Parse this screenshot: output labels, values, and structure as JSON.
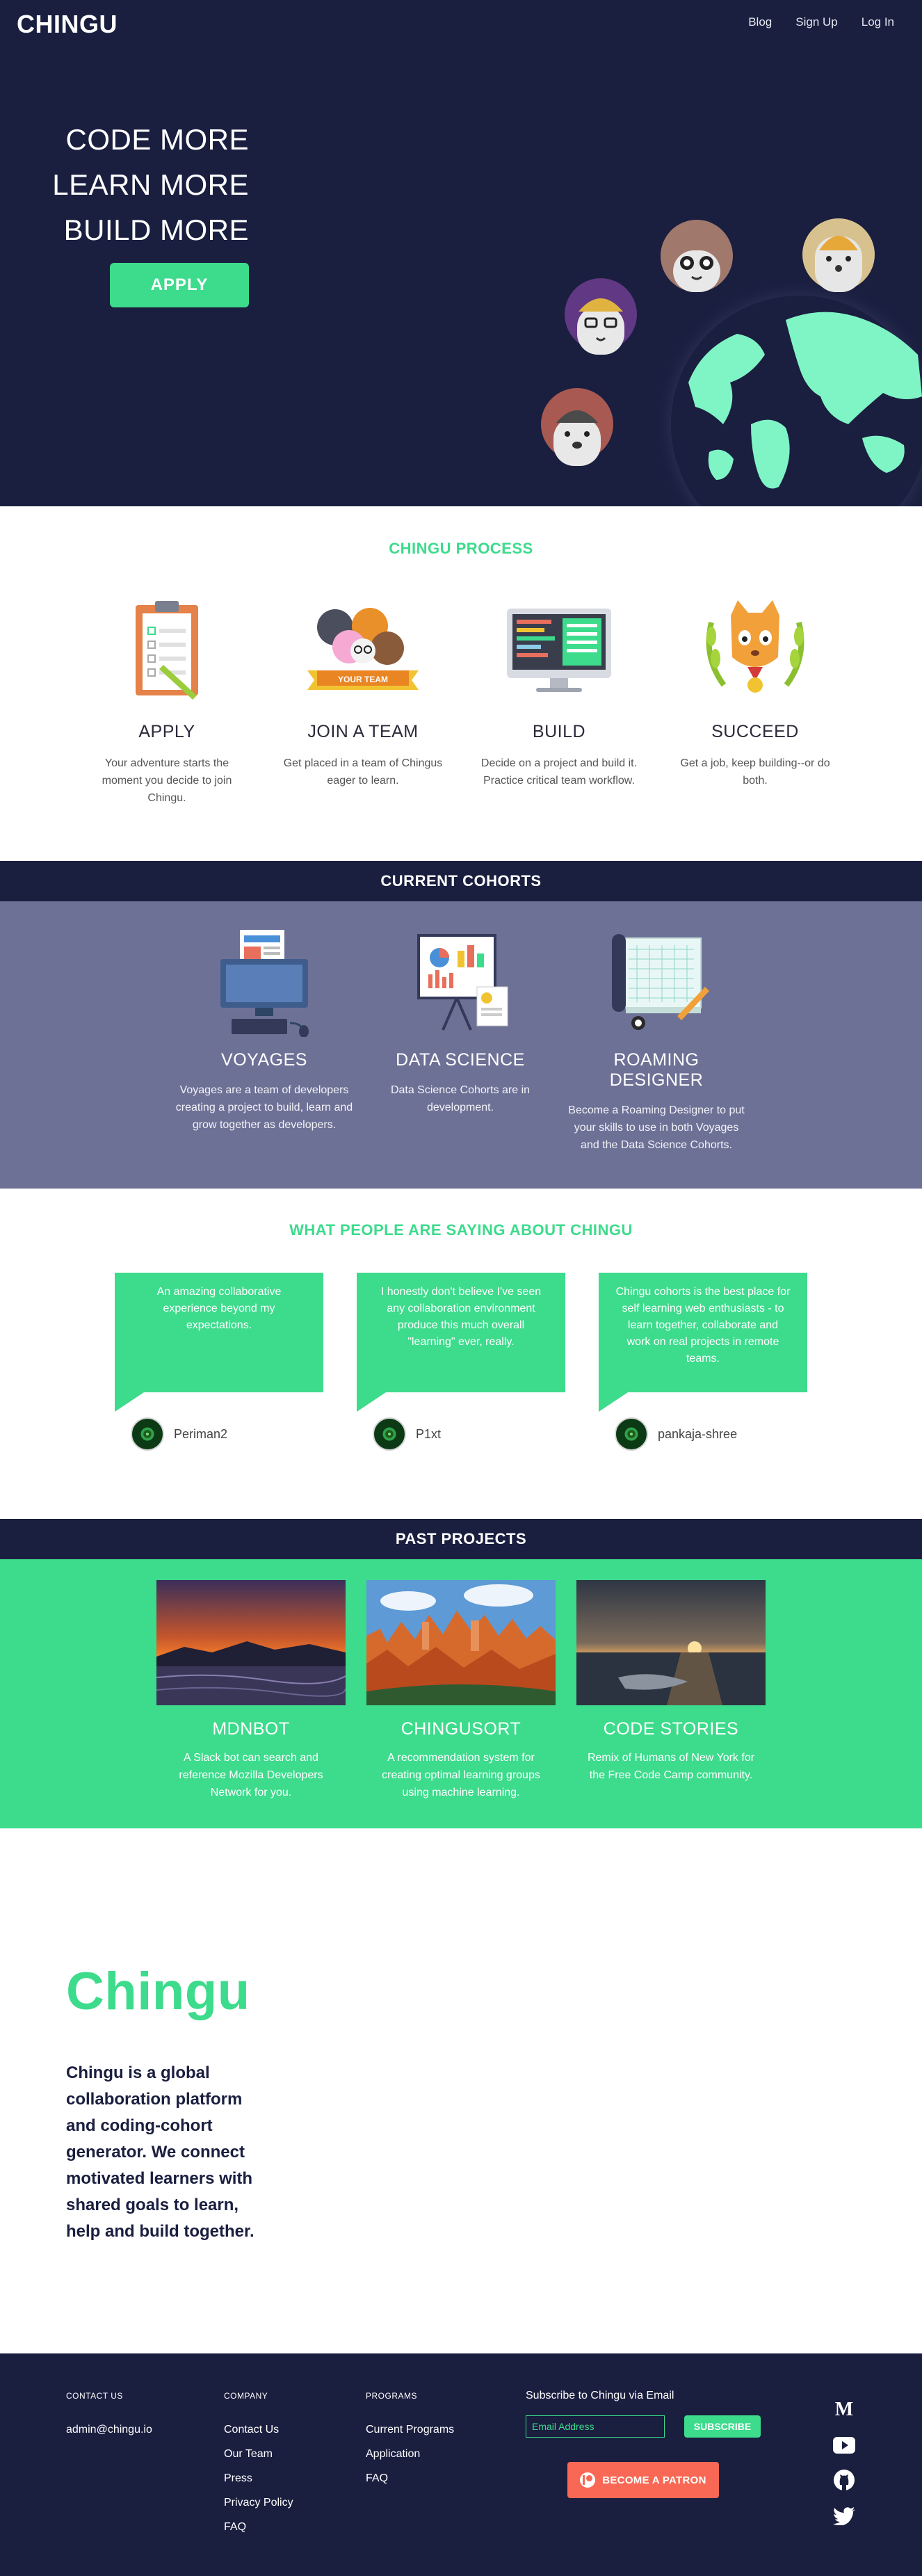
{
  "header": {
    "logo": "CHINGU",
    "nav": [
      "Blog",
      "Sign Up",
      "Log In"
    ]
  },
  "hero": {
    "lines": [
      "CODE MORE",
      "LEARN MORE",
      "BUILD MORE"
    ],
    "apply_label": "APPLY"
  },
  "process": {
    "title": "CHINGU PROCESS",
    "items": [
      {
        "title": "APPLY",
        "text": "Your adventure starts the moment you decide to join Chingu.",
        "icon": "clipboard-icon"
      },
      {
        "title": "JOIN A TEAM",
        "text": "Get placed in a team of Chingus eager to learn.",
        "icon": "team-icon",
        "banner": "YOUR TEAM"
      },
      {
        "title": "BUILD",
        "text": "Decide on a project and build it. Practice critical team workflow.",
        "icon": "monitor-icon"
      },
      {
        "title": "SUCCEED",
        "text": "Get a job, keep building--or do both.",
        "icon": "trophy-icon"
      }
    ]
  },
  "cohorts": {
    "title": "CURRENT COHORTS",
    "items": [
      {
        "title": "VOYAGES",
        "text": "Voyages are a team of developers creating a project to build, learn and grow together as developers.",
        "icon": "computer-icon"
      },
      {
        "title": "DATA SCIENCE",
        "text": "Data Science Cohorts are in development.",
        "icon": "presentation-icon"
      },
      {
        "title": "ROAMING DESIGNER",
        "text": "Become a Roaming Designer to put your skills to use in both Voyages and the Data Science Cohorts.",
        "icon": "blueprint-icon"
      }
    ]
  },
  "testimonials": {
    "title": "WHAT PEOPLE ARE SAYING ABOUT CHINGU",
    "items": [
      {
        "quote": "An amazing collaborative experience beyond my expectations.",
        "author": "Periman2"
      },
      {
        "quote": "I honestly don't believe I've seen any collaboration environment produce this much overall \"learning\" ever, really.",
        "author": "P1xt"
      },
      {
        "quote": "Chingu cohorts is the best place for self learning web enthusiasts - to learn together, collaborate and work on real projects in remote teams.",
        "author": "pankaja-shree"
      }
    ]
  },
  "projects": {
    "title": "PAST PROJECTS",
    "items": [
      {
        "title": "MDNBOT",
        "text": "A Slack bot can search and reference Mozilla Developers Network for you."
      },
      {
        "title": "CHINGUSORT",
        "text": "A recommendation system for creating optimal learning groups using machine learning."
      },
      {
        "title": "CODE STORIES",
        "text": "Remix of Humans of New York for the Free Code Camp community."
      }
    ]
  },
  "about": {
    "logo": "Chingu",
    "text": "Chingu is a global collaboration platform and coding-cohort generator. We connect motivated learners with shared goals to learn, help and build together."
  },
  "footer": {
    "contact_head": "CONTACT US",
    "email": "admin@chingu.io",
    "company_head": "COMPANY",
    "company_links": [
      "Contact Us",
      "Our Team",
      "Press",
      "Privacy Policy",
      "FAQ"
    ],
    "programs_head": "PROGRAMS",
    "program_links": [
      "Current Programs",
      "Application",
      "FAQ"
    ],
    "subscribe_label": "Subscribe to Chingu via Email",
    "email_placeholder": "Email Address",
    "subscribe_button": "SUBSCRIBE",
    "patron_button": "BECOME A PATRON",
    "social": [
      "medium-icon",
      "youtube-icon",
      "github-icon",
      "twitter-icon"
    ]
  },
  "colors": {
    "navy": "#1a1e3f",
    "green": "#3ddb8c",
    "slate": "#6e7196",
    "patreon": "#f96854"
  }
}
